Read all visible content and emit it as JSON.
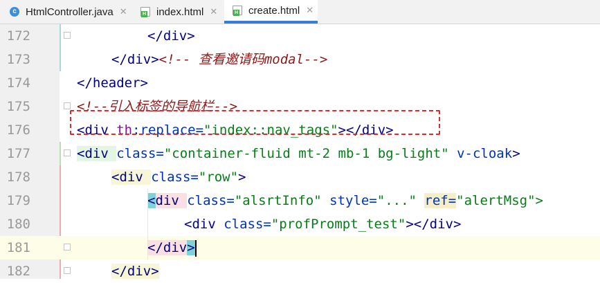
{
  "tabs": [
    {
      "label": "HtmlController.java",
      "icon": "java-class-icon",
      "active": false
    },
    {
      "label": "index.html",
      "icon": "html-file-icon",
      "active": false
    },
    {
      "label": "create.html",
      "icon": "html-file-icon",
      "active": true
    }
  ],
  "tab_close_glyph": "✕",
  "java_icon_letter": "c",
  "colors": {
    "tag": "#000080",
    "attribute": "#0033b3",
    "value": "#067d17",
    "comment": "#8b1a1a",
    "line_number": "#999999",
    "highlight_box": "#d32f2f",
    "active_tab_underline": "#3a7bd5"
  },
  "editor": {
    "current_line": 181,
    "highlighted_line": 176,
    "lines": [
      {
        "n": "172",
        "indent": "      ",
        "parts": [
          [
            "</",
            "tg"
          ],
          [
            "div",
            "tg"
          ],
          [
            ">",
            "tg"
          ]
        ]
      },
      {
        "n": "173",
        "indent": "  ",
        "parts": [
          [
            "</div>",
            "tg"
          ],
          [
            "<!-- ",
            "cmr"
          ],
          [
            "查看邀请码modal",
            "cmr"
          ],
          [
            "-->",
            "cmr"
          ]
        ]
      },
      {
        "n": "174",
        "indent": "",
        "parts": [
          [
            "</header>",
            "tg"
          ]
        ]
      },
      {
        "n": "175",
        "indent": "",
        "parts": [
          [
            "<!--引入标签的导航栏-->",
            "cmr"
          ]
        ]
      },
      {
        "n": "176",
        "indent": "",
        "parts": [
          [
            "<div ",
            "tg"
          ],
          [
            "th",
            "ns"
          ],
          [
            ":replace=",
            "at"
          ],
          [
            "\"index::nav_tags\"",
            "av"
          ],
          [
            "></div>",
            "tg"
          ]
        ]
      },
      {
        "n": "177",
        "indent": "",
        "parts": [
          [
            "<div ",
            "tg"
          ],
          [
            "class=",
            "at"
          ],
          [
            "\"container-fluid mt-2 mb-1 bg-light\"",
            "av"
          ],
          [
            " ",
            "dk"
          ],
          [
            "v-cloak",
            "at"
          ],
          [
            ">",
            "tg"
          ]
        ]
      },
      {
        "n": "178",
        "indent": "",
        "parts": [
          [
            "<div ",
            "tg"
          ],
          [
            "class=",
            "at"
          ],
          [
            "\"row\"",
            "av"
          ],
          [
            ">",
            "tg"
          ]
        ]
      },
      {
        "n": "179",
        "indent": "",
        "parts": [
          [
            "<div ",
            "tg"
          ],
          [
            "class=",
            "at"
          ],
          [
            "\"alsrtInfo\" ",
            "av"
          ],
          [
            "style=",
            "at"
          ],
          [
            "\"...\" ",
            "av"
          ],
          [
            "ref=",
            "at"
          ],
          [
            "\"alertMsg\">",
            "av"
          ]
        ]
      },
      {
        "n": "180",
        "indent": "",
        "parts": [
          [
            "<div ",
            "tg"
          ],
          [
            "class=",
            "at"
          ],
          [
            "\"profPrompt_test\"",
            "av"
          ],
          [
            "></div>",
            "tg"
          ]
        ]
      },
      {
        "n": "181",
        "indent": "",
        "parts": [
          [
            "</div>",
            "tg"
          ]
        ]
      },
      {
        "n": "182",
        "indent": "",
        "parts": [
          [
            "</div>",
            "tg"
          ]
        ]
      }
    ]
  }
}
